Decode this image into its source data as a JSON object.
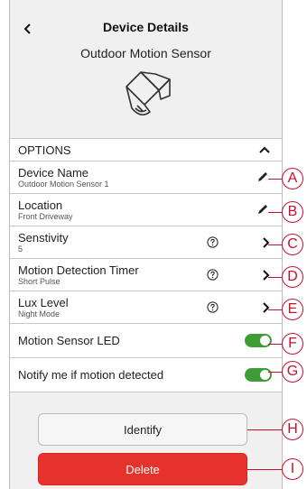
{
  "header": {
    "title": "Device Details",
    "subtitle": "Outdoor Motion Sensor"
  },
  "options": {
    "label": "OPTIONS"
  },
  "rows": [
    {
      "label": "Device Name",
      "value": "Outdoor Motion Sensor 1",
      "icon": "pencil-icon"
    },
    {
      "label": "Location",
      "value": "Front Driveway",
      "icon": "pencil-icon"
    },
    {
      "label": "Senstivity",
      "value": "5",
      "icon": "chevron-right-icon",
      "help": true
    },
    {
      "label": "Motion Detection Timer",
      "value": "Short Pulse",
      "icon": "chevron-right-icon",
      "help": true
    },
    {
      "label": "Lux Level",
      "value": "Night Mode",
      "icon": "chevron-right-icon",
      "help": true
    }
  ],
  "toggles": [
    {
      "label": "Motion Sensor LED",
      "on": true
    },
    {
      "label": "Notify me if motion detected",
      "on": true
    }
  ],
  "buttons": {
    "identify": "Identify",
    "delete": "Delete"
  },
  "callouts": [
    "A",
    "B",
    "C",
    "D",
    "E",
    "F",
    "G",
    "H",
    "I"
  ],
  "colors": {
    "toggle_on": "#3f9c35",
    "delete": "#e7312c",
    "callout": "#c8102e"
  }
}
